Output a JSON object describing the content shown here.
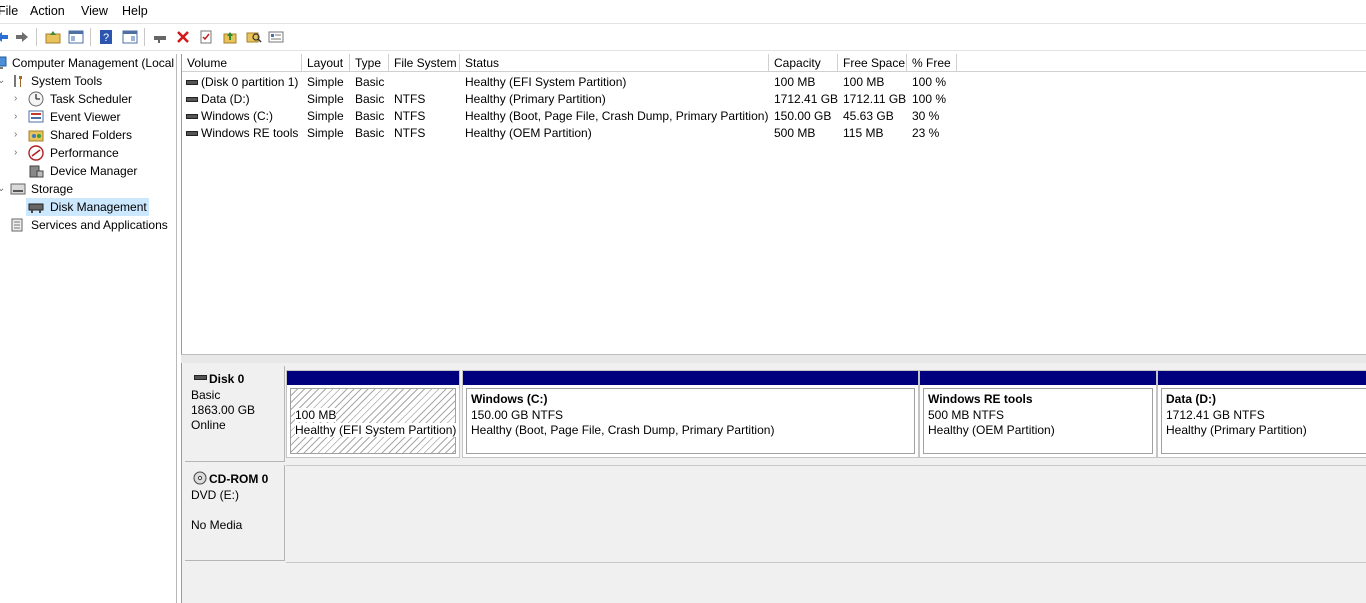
{
  "menu": {
    "file": "File",
    "action": "Action",
    "view": "View",
    "help": "Help"
  },
  "tree": {
    "root": "Computer Management (Local",
    "system_tools": "System Tools",
    "task_scheduler": "Task Scheduler",
    "event_viewer": "Event Viewer",
    "shared_folders": "Shared Folders",
    "performance": "Performance",
    "device_manager": "Device Manager",
    "storage": "Storage",
    "disk_management": "Disk Management",
    "services_apps": "Services and Applications"
  },
  "columns": {
    "volume": "Volume",
    "layout": "Layout",
    "type": "Type",
    "fs": "File System",
    "status": "Status",
    "capacity": "Capacity",
    "free": "Free Space",
    "pct": "% Free"
  },
  "volumes": [
    {
      "volume": "(Disk 0 partition 1)",
      "layout": "Simple",
      "type": "Basic",
      "fs": "",
      "status": "Healthy (EFI System Partition)",
      "capacity": "100 MB",
      "free": "100 MB",
      "pct": "100 %"
    },
    {
      "volume": "Data (D:)",
      "layout": "Simple",
      "type": "Basic",
      "fs": "NTFS",
      "status": "Healthy (Primary Partition)",
      "capacity": "1712.41 GB",
      "free": "1712.11 GB",
      "pct": "100 %"
    },
    {
      "volume": "Windows (C:)",
      "layout": "Simple",
      "type": "Basic",
      "fs": "NTFS",
      "status": "Healthy (Boot, Page File, Crash Dump, Primary Partition)",
      "capacity": "150.00 GB",
      "free": "45.63 GB",
      "pct": "30 %"
    },
    {
      "volume": "Windows RE tools",
      "layout": "Simple",
      "type": "Basic",
      "fs": "NTFS",
      "status": "Healthy (OEM Partition)",
      "capacity": "500 MB",
      "free": "115 MB",
      "pct": "23 %"
    }
  ],
  "disk0": {
    "name": "Disk 0",
    "type": "Basic",
    "size": "1863.00 GB",
    "state": "Online",
    "partitions": [
      {
        "name": "",
        "size": "100 MB",
        "status": "Healthy (EFI System Partition)"
      },
      {
        "name": "Windows  (C:)",
        "size": "150.00 GB NTFS",
        "status": "Healthy (Boot, Page File, Crash Dump, Primary Partition)"
      },
      {
        "name": "Windows RE tools",
        "size": "500 MB NTFS",
        "status": "Healthy (OEM Partition)"
      },
      {
        "name": "Data  (D:)",
        "size": "1712.41 GB NTFS",
        "status": "Healthy (Primary Partition)"
      }
    ]
  },
  "cdrom0": {
    "name": "CD-ROM 0",
    "type": "DVD (E:)",
    "media": "No Media"
  },
  "colors": {
    "partition_bar": "#00007f",
    "selection": "#cce8ff"
  }
}
